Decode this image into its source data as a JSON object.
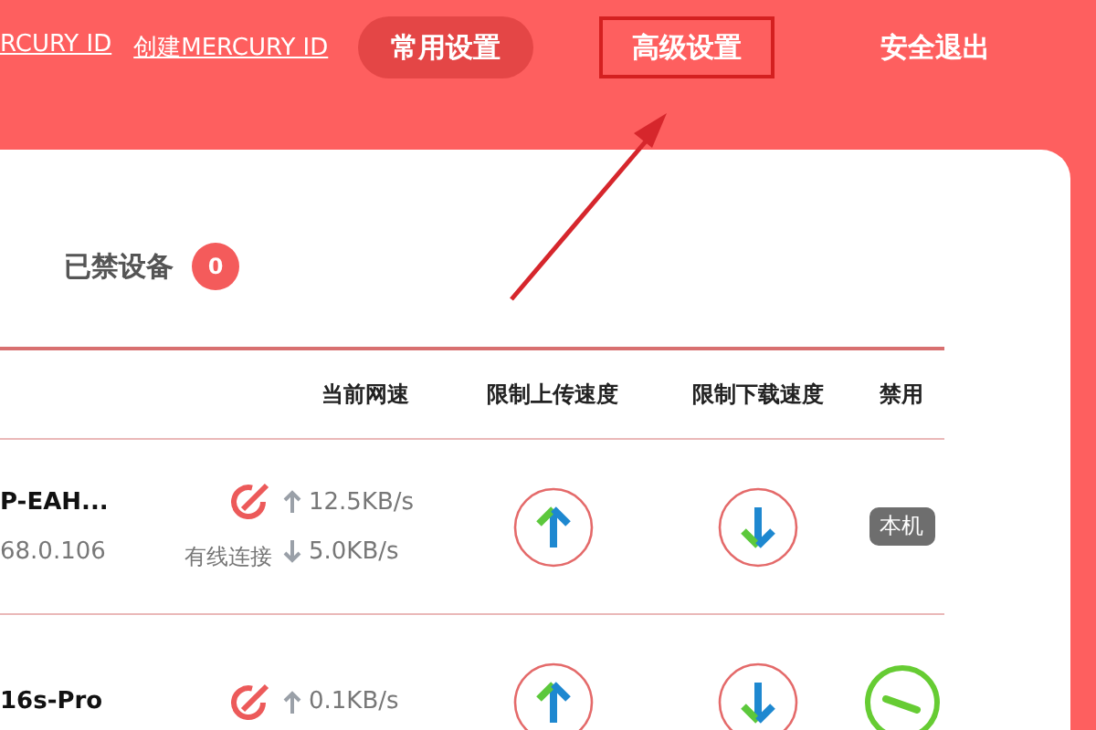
{
  "header": {
    "links": [
      "RCURY ID",
      "创建MERCURY ID"
    ],
    "nav": [
      {
        "label": "常用设置",
        "selected": true,
        "highlighted": false
      },
      {
        "label": "高级设置",
        "selected": false,
        "highlighted": true
      },
      {
        "label": "安全退出",
        "selected": false,
        "highlighted": false
      }
    ]
  },
  "annotation": {
    "kind": "arrow"
  },
  "blocked": {
    "label": "已禁设备",
    "count": "0"
  },
  "table": {
    "columns": [
      "当前网速",
      "限制上传速度",
      "限制下载速度",
      "禁用"
    ],
    "rows": [
      {
        "name": "P-EAH...",
        "ip": "68.0.106",
        "connection": "有线连接",
        "up": "12.5KB/s",
        "down": "5.0KB/s",
        "ban": {
          "kind": "badge",
          "label": "本机"
        }
      },
      {
        "name": "16s-Pro",
        "up": "0.1KB/s",
        "ban": {
          "kind": "toggle"
        }
      }
    ]
  }
}
